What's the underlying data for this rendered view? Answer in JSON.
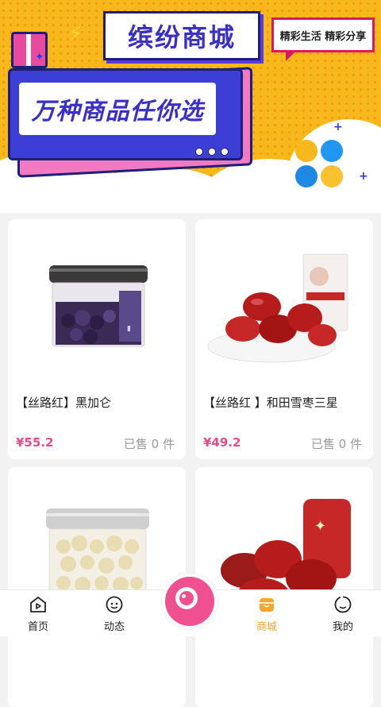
{
  "banner": {
    "title": "缤纷商城",
    "tagline": "精彩生活 精彩分享",
    "slogan": "万种商品任你选"
  },
  "products": [
    {
      "name": "【丝路红】黑加仑",
      "price": "¥55.2",
      "sold": "已售 0 件"
    },
    {
      "name": "【丝路红 】和田雪枣三星",
      "price": "¥49.2",
      "sold": "已售 0 件"
    },
    {
      "name": "",
      "price": "",
      "sold": ""
    },
    {
      "name": "",
      "price": "",
      "sold": ""
    }
  ],
  "tabs": [
    {
      "label": "首页",
      "icon": "home-play-icon"
    },
    {
      "label": "动态",
      "icon": "chat-icon"
    },
    {
      "label": "",
      "icon": "camera-icon"
    },
    {
      "label": "商城",
      "icon": "shop-icon"
    },
    {
      "label": "我的",
      "icon": "profile-icon"
    }
  ],
  "colors": {
    "accent": "#f0508f",
    "price": "#e84a8a",
    "active_tab": "#f6a52d",
    "brand_blue": "#3b2fc9"
  }
}
